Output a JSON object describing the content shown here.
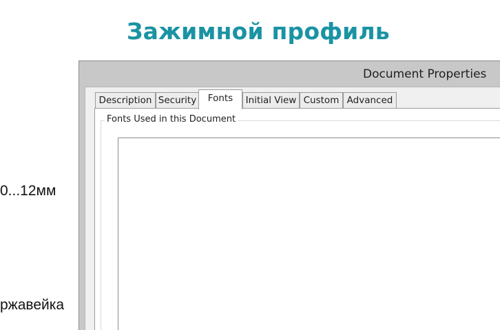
{
  "background": {
    "heading": "Зажимной профиль",
    "text_lines": [
      "0...12мм",
      "ржавейка"
    ],
    "heading_color": "#1a93a3"
  },
  "dialog": {
    "title": "Document Properties",
    "tabs": [
      {
        "label": "Description",
        "active": false
      },
      {
        "label": "Security",
        "active": false
      },
      {
        "label": "Fonts",
        "active": true
      },
      {
        "label": "Initial View",
        "active": false
      },
      {
        "label": "Custom",
        "active": false
      },
      {
        "label": "Advanced",
        "active": false
      }
    ],
    "fonts_tab": {
      "group_label": "Fonts Used in this Document",
      "fonts": []
    }
  }
}
